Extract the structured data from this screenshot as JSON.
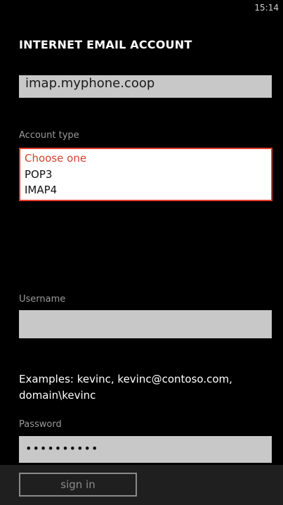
{
  "status_bar": {
    "time": "15:14"
  },
  "page": {
    "title": "INTERNET EMAIL ACCOUNT"
  },
  "server_field": {
    "value": "imap.myphone.coop"
  },
  "account_type": {
    "label": "Account type",
    "options": [
      "Choose one",
      "POP3",
      "IMAP4"
    ],
    "selected_index": 0,
    "expanded": true
  },
  "username": {
    "label": "Username",
    "value": ""
  },
  "examples_text": {
    "line1": "Examples: kevinc, kevinc@contoso.com,",
    "line2": "domain\\kevinc"
  },
  "password": {
    "label": "Password",
    "masked_value": "••••••••••"
  },
  "app_bar": {
    "sign_in_label": "sign in"
  },
  "colors": {
    "background": "#000000",
    "accent": "#e53b2a",
    "field_background": "#c8c8c8",
    "label_gray": "#9a9a9a",
    "app_bar": "#1f1f1f"
  }
}
